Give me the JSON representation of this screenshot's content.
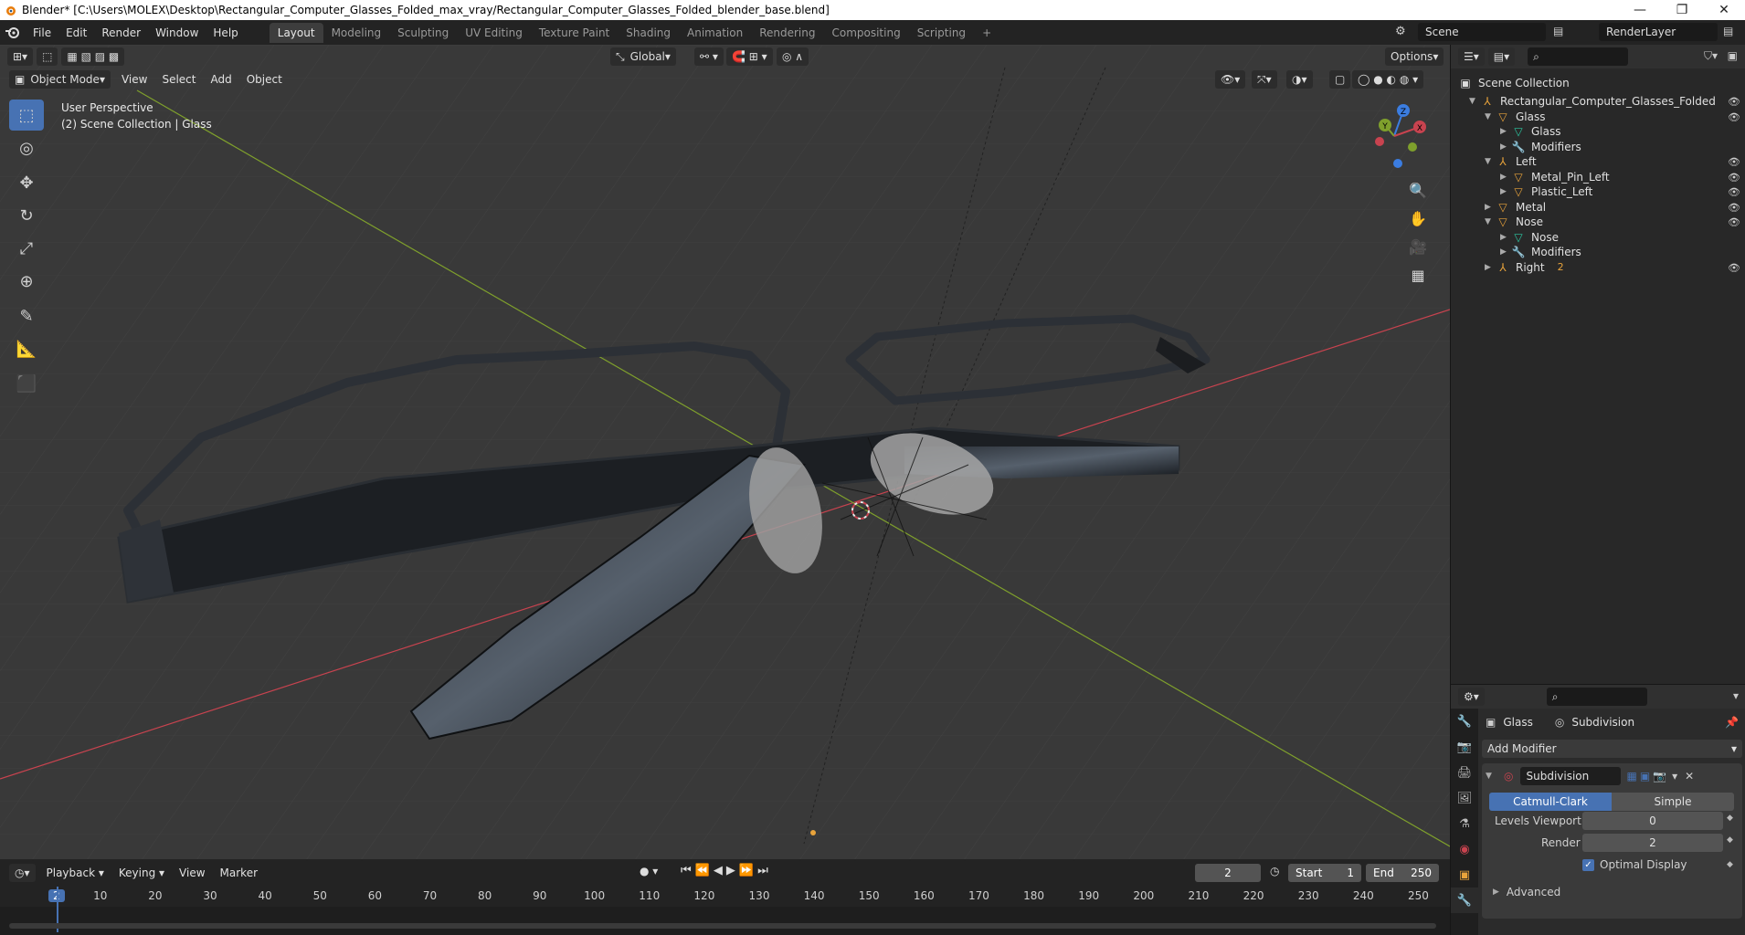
{
  "titlebar": {
    "title": "Blender* [C:\\Users\\MOLEX\\Desktop\\Rectangular_Computer_Glasses_Folded_max_vray/Rectangular_Computer_Glasses_Folded_blender_base.blend]",
    "minimize": "—",
    "maximize": "❐",
    "close": "✕"
  },
  "menu": [
    "File",
    "Edit",
    "Render",
    "Window",
    "Help"
  ],
  "workspaces": [
    "Layout",
    "Modeling",
    "Sculpting",
    "UV Editing",
    "Texture Paint",
    "Shading",
    "Animation",
    "Rendering",
    "Compositing",
    "Scripting"
  ],
  "workspace_add": "+",
  "scene": "Scene",
  "render_layer": "RenderLayer",
  "viewport": {
    "transform_orientation": "Global",
    "options": "Options",
    "mode": "Object Mode",
    "menus": [
      "View",
      "Select",
      "Add",
      "Object"
    ],
    "perspective": "User Perspective",
    "collection_info": "(2) Scene Collection | Glass",
    "gizmo": {
      "z": "Z",
      "y": "Y",
      "x": "X"
    }
  },
  "outliner": {
    "root": "Scene Collection",
    "rows": [
      {
        "label": "Rectangular_Computer_Glasses_Folded",
        "type": "empty",
        "depth": 0,
        "expanded": true
      },
      {
        "label": "Glass",
        "type": "object",
        "depth": 1,
        "expanded": true
      },
      {
        "label": "Glass",
        "type": "mesh",
        "depth": 2,
        "expanded": false
      },
      {
        "label": "Modifiers",
        "type": "modifier",
        "depth": 2,
        "expanded": false
      },
      {
        "label": "Left",
        "type": "empty",
        "depth": 1,
        "expanded": true
      },
      {
        "label": "Metal_Pin_Left",
        "type": "object",
        "depth": 2,
        "expanded": false
      },
      {
        "label": "Plastic_Left",
        "type": "object",
        "depth": 2,
        "expanded": false
      },
      {
        "label": "Metal",
        "type": "object",
        "depth": 1,
        "expanded": false
      },
      {
        "label": "Nose",
        "type": "object",
        "depth": 1,
        "expanded": true
      },
      {
        "label": "Nose",
        "type": "mesh",
        "depth": 2,
        "expanded": false
      },
      {
        "label": "Modifiers",
        "type": "modifier",
        "depth": 2,
        "expanded": false
      },
      {
        "label": "Right",
        "type": "empty",
        "depth": 1,
        "expanded": false
      }
    ],
    "right_subscript": "2"
  },
  "properties": {
    "object": "Glass",
    "modifier_context": "Subdivision",
    "add_modifier": "Add Modifier",
    "modifier_name": "Subdivision",
    "modes": [
      "Catmull-Clark",
      "Simple"
    ],
    "levels_viewport_label": "Levels Viewport",
    "levels_viewport": "0",
    "render_label": "Render",
    "render": "2",
    "optimal_display": "Optimal Display",
    "advanced": "Advanced"
  },
  "timeline": {
    "menus": [
      "Playback",
      "Keying",
      "View",
      "Marker"
    ],
    "current_frame": "2",
    "start_label": "Start",
    "start": "1",
    "end_label": "End",
    "end": "250",
    "ruler": [
      "2",
      "10",
      "20",
      "30",
      "40",
      "50",
      "60",
      "70",
      "80",
      "90",
      "100",
      "110",
      "120",
      "130",
      "140",
      "150",
      "160",
      "170",
      "180",
      "190",
      "200",
      "210",
      "220",
      "230",
      "240",
      "250"
    ]
  },
  "colors": {
    "accent": "#4772b3",
    "x_axis": "#c8434f",
    "y_axis": "#7fa02c",
    "z_axis": "#3b7de1",
    "viewport_bg": "#393939"
  }
}
